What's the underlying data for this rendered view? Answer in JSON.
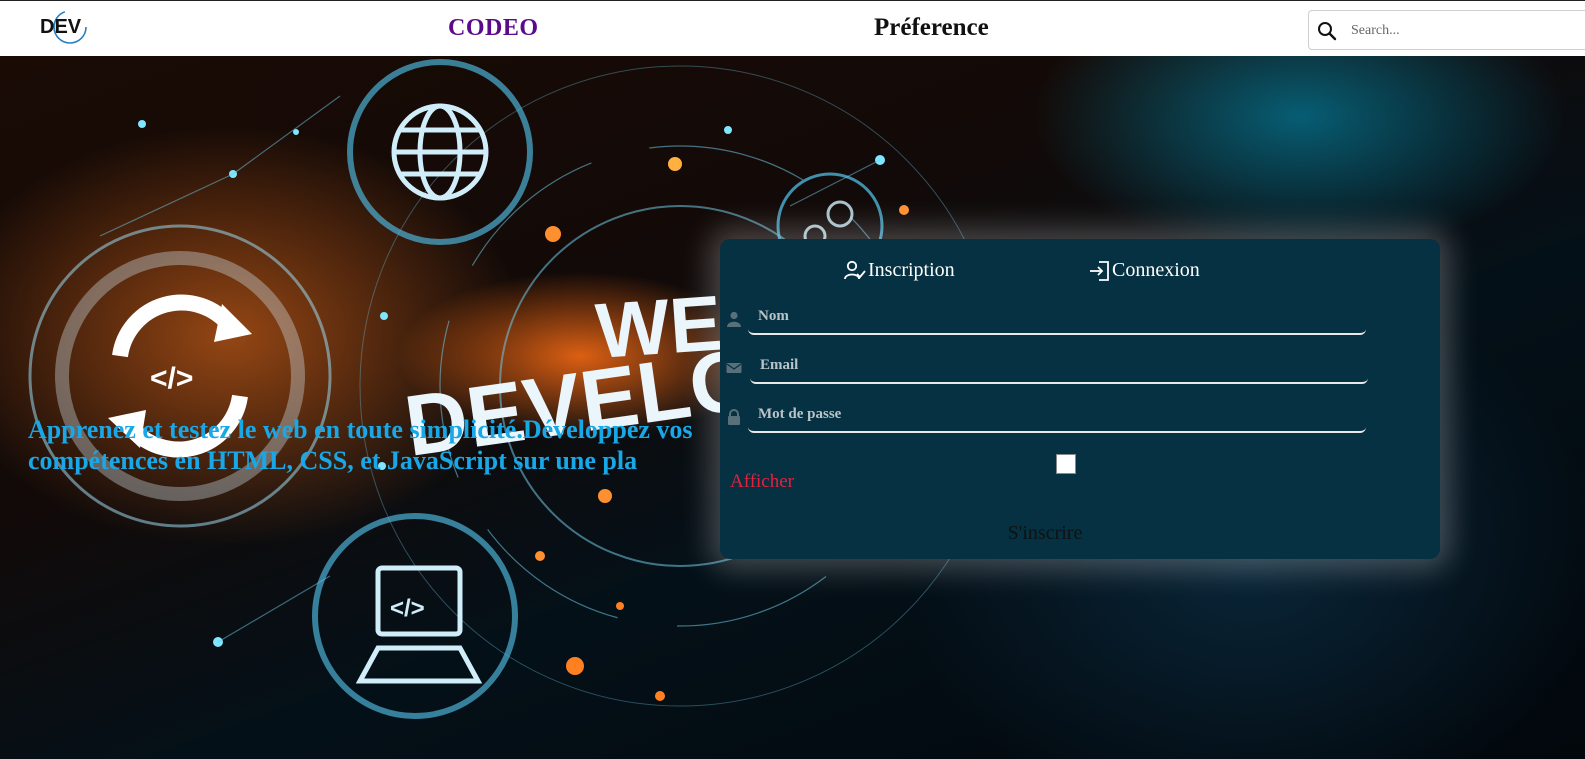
{
  "header": {
    "logo_text": "DEV",
    "brand": "CODEO",
    "preference": "Préference",
    "search": {
      "placeholder": "Search..."
    }
  },
  "hero": {
    "tagline": "Apprenez et testez le web en toute simplicité.Développez vos compétences en HTML, CSS, et JavaScript sur une pla",
    "background_words": [
      "WEB",
      "DEVELOPI"
    ]
  },
  "form": {
    "tabs": [
      {
        "label": "Inscription",
        "icon": "user-check-icon"
      },
      {
        "label": "Connexion",
        "icon": "login-icon"
      }
    ],
    "fields": [
      {
        "placeholder": "Nom",
        "icon": "user-icon"
      },
      {
        "placeholder": "Email",
        "icon": "envelope-icon"
      },
      {
        "placeholder": "Mot de passe",
        "icon": "lock-icon"
      }
    ],
    "show_password_label": "Afficher",
    "submit_label": "S'inscrire"
  },
  "colors": {
    "brand": "#5a0a8a",
    "tagline": "#18a8e8",
    "panel": "#053142",
    "afficher": "#e8203c"
  }
}
